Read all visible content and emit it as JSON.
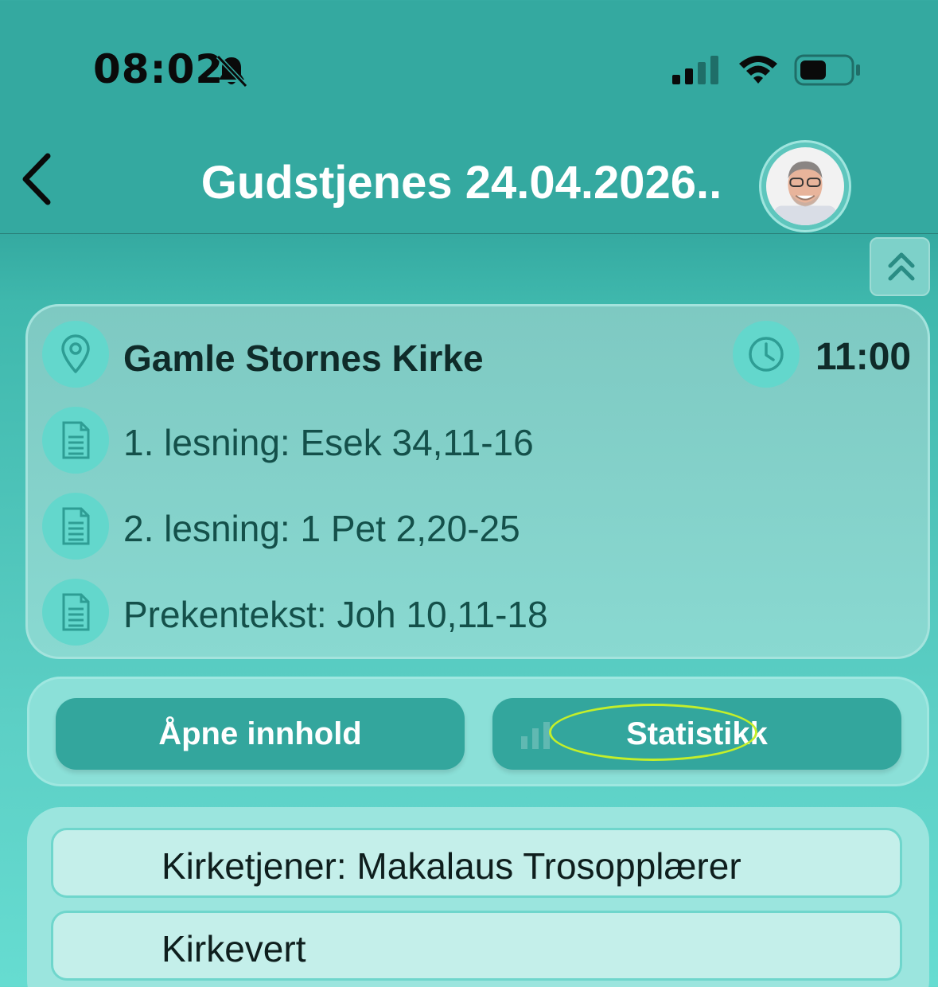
{
  "status_bar": {
    "time": "08:02",
    "icons": [
      "bell-slash-icon",
      "signal-icon",
      "wifi-icon",
      "battery-icon"
    ]
  },
  "nav": {
    "back_icon": "chevron-left-icon",
    "title": "Gudstjenes 24.04.2026..",
    "avatar": "user-avatar",
    "collapse_icon": "double-chevron-up-icon"
  },
  "service": {
    "location_icon": "map-pin-icon",
    "church": "Gamle Stornes Kirke",
    "time_icon": "clock-icon",
    "time": "11:00",
    "readings": [
      {
        "icon": "document-icon",
        "text": "1. lesning: Esek 34,11-16"
      },
      {
        "icon": "document-icon",
        "text": "2. lesning: 1 Pet 2,20-25"
      },
      {
        "icon": "document-icon",
        "text": "Prekentekst: Joh 10,11-18"
      }
    ]
  },
  "actions": {
    "open_content": "Åpne innhold",
    "statistics": "Statistikk"
  },
  "roles": [
    {
      "label": "Kirketjener: Makalaus Trosopplærer"
    },
    {
      "label": "Kirkevert"
    }
  ],
  "colors": {
    "header_bg": "#34a9a0",
    "button_bg": "#33a69d",
    "highlight": "#c4ef2a"
  }
}
